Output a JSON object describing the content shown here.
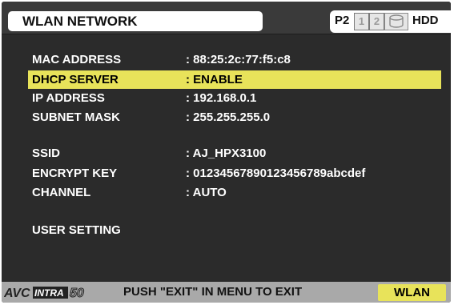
{
  "header": {
    "title": "WLAN NETWORK",
    "media": {
      "p2_label": "P2",
      "slot1": "1",
      "slot2": "2",
      "hdd_label": "HDD"
    }
  },
  "rows": [
    {
      "label": "MAC ADDRESS",
      "value": ": 88:25:2c:77:f5:c8"
    },
    {
      "label": "DHCP SERVER",
      "value": ": ENABLE",
      "selected": true
    },
    {
      "label": "IP ADDRESS",
      "value": ": 192.168.0.1"
    },
    {
      "label": "SUBNET MASK",
      "value": ": 255.255.255.0"
    },
    {
      "label": "SSID",
      "value": ": AJ_HPX3100"
    },
    {
      "label": "ENCRYPT KEY",
      "value": ": 01234567890123456789abcdef"
    },
    {
      "label": "CHANNEL",
      "value": ": AUTO"
    },
    {
      "label": "USER SETTING",
      "value": ""
    }
  ],
  "footer": {
    "logo_text": "AVC INTRA 50",
    "message": "PUSH \"EXIT\" IN MENU TO EXIT",
    "wlan_button": "WLAN"
  },
  "colors": {
    "highlight": "#e8e35a",
    "background": "#2b2b2b",
    "footer": "#a9a9a9"
  }
}
